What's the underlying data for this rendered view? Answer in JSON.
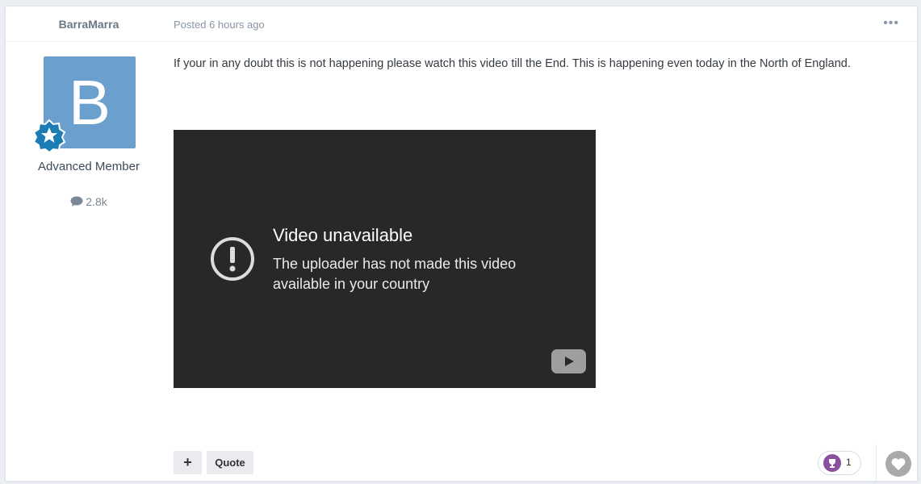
{
  "post": {
    "author": "BarraMarra",
    "date": "Posted 6 hours ago",
    "avatar_letter": "B",
    "avatar_color": "#6b9fcd",
    "rank_title": "Advanced Member",
    "post_count": "2.8k",
    "body": "If your in any doubt this is not happening please watch this video till the End. This is happening even today in the North of England."
  },
  "video": {
    "title": "Video unavailable",
    "message": "The uploader has not made this video available in your country",
    "background": "#282828"
  },
  "actions": {
    "plus": "+",
    "quote": "Quote",
    "reaction_count": "1",
    "more_icon": "ellipsis-icon",
    "like_icon": "heart-icon",
    "reaction_icon": "trophy-icon"
  }
}
